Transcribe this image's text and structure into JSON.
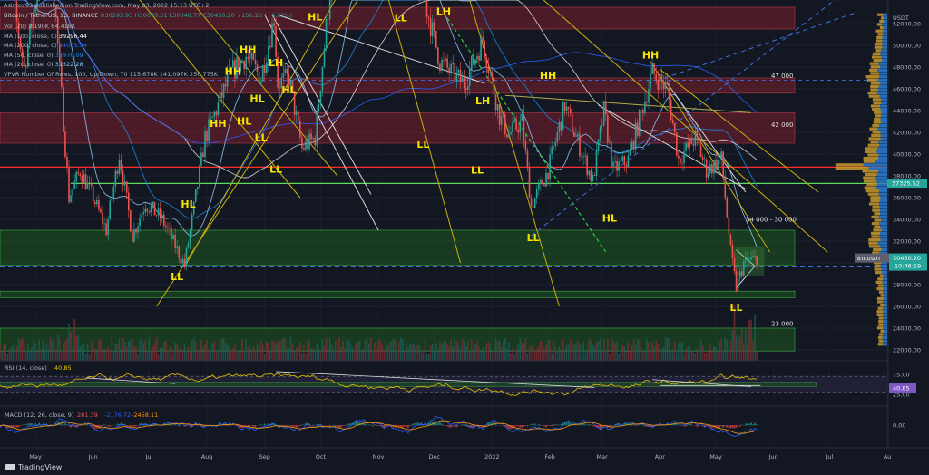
{
  "publish_line": "Asimov93 published on TradingView.com, May 23, 2022 15:13 UTC+2",
  "symbol_line": "Bitcoin / TetherUS, 1D, BINANCE",
  "ohlc": "O30293.93 H30670.51 L30048.77 C30450.20 +156.26 (+0.52%)",
  "indicators": [
    {
      "label": "Vol (20)",
      "value": "2.190K 64.418K",
      "color": "#b2b5be"
    },
    {
      "label": "MA (100, close, 0)",
      "value": "39296.44",
      "color": "#ffffff"
    },
    {
      "label": "MA (200, close, 0)",
      "value": "44003.54",
      "color": "#2962ff"
    },
    {
      "label": "MA (50, close, 0)",
      "value": "36976.09",
      "color": "#1e88e5"
    },
    {
      "label": "MA (20, close, 0)",
      "value": "31522.28",
      "color": "#90caf9"
    },
    {
      "label": "VPVR Number Of Rows, 100, Up/Down, 70",
      "value": "115.678K 141.097K 256.775K",
      "color": "#b2b5be"
    }
  ],
  "watermark": "TradingView",
  "colors": {
    "bg": "#131722",
    "up": "#26a69a",
    "down": "#ef5350",
    "label": "#f5e400",
    "resistance_zone": "#7a1f2b",
    "support_zone": "#1b5e20",
    "trendline_yellow": "#c9b10c",
    "trendline_white": "#d8d8d8",
    "dash_blue": "#3d6fe0",
    "hline_red": "#ff2a2a",
    "hline_green": "#5cdb5c",
    "vp_up": "#2b7cd3",
    "vp_down": "#c99a2e",
    "rsi": "#e6c200",
    "macd": "#2962ff",
    "signal": "#ff9800"
  },
  "chart_data": {
    "type": "candlestick",
    "title": "Bitcoin / TetherUS, 1D, BINANCE",
    "price_axis": {
      "ticks": [
        "52000.00",
        "50000.00",
        "48000.00",
        "46000.00",
        "44000.00",
        "42000.00",
        "40000.00",
        "38000.00",
        "36000.00",
        "34000.00",
        "32000.00",
        "30000.00",
        "28000.00",
        "26000.00",
        "24000.00",
        "22000.00"
      ],
      "ylim": [
        21000,
        53500
      ],
      "currency": "USDT",
      "price_label": {
        "symbol": "BTCUSDT",
        "value": "30450.20",
        "countdown": "10:46:19"
      },
      "ma_label": "37325.52"
    },
    "time_axis": {
      "labels": [
        "May",
        "Jun",
        "Jul",
        "Aug",
        "Sep",
        "Oct",
        "Nov",
        "Dec",
        "2022",
        "Feb",
        "Mar",
        "Apr",
        "May",
        "Jun",
        "Jul",
        "Au"
      ]
    },
    "annotations": {
      "zone_labels": [
        "47 000",
        "42 000",
        "34 000 - 30 000",
        "23 000"
      ],
      "swing_labels": [
        {
          "text": "HL",
          "date": "2021-09-28",
          "price": 52300
        },
        {
          "text": "LL",
          "date": "2021-11-13",
          "price": 52200
        },
        {
          "text": "LH",
          "date": "2021-12-06",
          "price": 52800
        },
        {
          "text": "HH",
          "date": "2021-08-23",
          "price": 49300
        },
        {
          "text": "HH",
          "date": "2021-08-15",
          "price": 47300
        },
        {
          "text": "LH",
          "date": "2021-09-07",
          "price": 48100
        },
        {
          "text": "HL",
          "date": "2021-09-14",
          "price": 45600
        },
        {
          "text": "HL",
          "date": "2021-08-28",
          "price": 44800
        },
        {
          "text": "HH",
          "date": "2021-08-07",
          "price": 42500
        },
        {
          "text": "HL",
          "date": "2021-08-21",
          "price": 42700
        },
        {
          "text": "LL",
          "date": "2021-08-30",
          "price": 41200
        },
        {
          "text": "LL",
          "date": "2021-09-07",
          "price": 38300
        },
        {
          "text": "HL",
          "date": "2021-07-22",
          "price": 35100
        },
        {
          "text": "LL",
          "date": "2021-07-16",
          "price": 28400
        },
        {
          "text": "LL",
          "date": "2021-11-25",
          "price": 40600
        },
        {
          "text": "LL",
          "date": "2021-12-24",
          "price": 38200
        },
        {
          "text": "LH",
          "date": "2021-12-27",
          "price": 44600
        },
        {
          "text": "HH",
          "date": "2022-01-31",
          "price": 46900
        },
        {
          "text": "HH",
          "date": "2022-03-27",
          "price": 48800
        },
        {
          "text": "HL",
          "date": "2022-03-05",
          "price": 33800
        },
        {
          "text": "LL",
          "date": "2022-01-23",
          "price": 32000
        },
        {
          "text": "LL",
          "date": "2022-05-12",
          "price": 25600
        }
      ],
      "price_levels": {
        "red_line": 38800,
        "green_line": 37300,
        "dashed_blue": 29700
      },
      "zones": [
        {
          "kind": "resistance",
          "from": 51500,
          "to": 53500
        },
        {
          "kind": "resistance",
          "from": 45600,
          "to": 47000
        },
        {
          "kind": "resistance",
          "from": 41000,
          "to": 43800
        },
        {
          "kind": "support",
          "from": 29800,
          "to": 33000
        },
        {
          "kind": "support",
          "from": 26800,
          "to": 27400
        },
        {
          "kind": "support",
          "from": 21900,
          "to": 24000
        }
      ]
    },
    "rsi": {
      "label": "RSI (14, close)",
      "value": "40.85",
      "ticks": [
        "75.00",
        "50.00",
        "25.00"
      ],
      "ylim": [
        0,
        100
      ]
    },
    "macd": {
      "label": "MACD (12, 26, close, 9)",
      "values": [
        "281.39",
        "-2176.72",
        "-2458.11"
      ],
      "ticks": [
        "0.00"
      ]
    }
  }
}
